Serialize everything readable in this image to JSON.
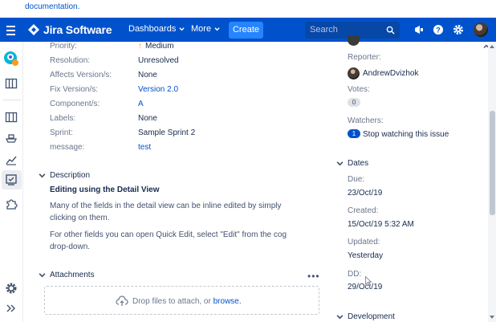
{
  "top_link": "documentation.",
  "nav": {
    "app_name": "Jira Software",
    "dashboards": "Dashboards",
    "more": "More",
    "create": "Create",
    "search_placeholder": "Search"
  },
  "fields": [
    {
      "label": "Priority:",
      "value": "Medium",
      "link": false,
      "icon": "priority-medium-arrow"
    },
    {
      "label": "Resolution:",
      "value": "Unresolved",
      "link": false
    },
    {
      "label": "Affects Version/s:",
      "value": "None",
      "link": false
    },
    {
      "label": "Fix Version/s:",
      "value": "Version 2.0",
      "link": true
    },
    {
      "label": "Component/s:",
      "value": "A",
      "link": true
    },
    {
      "label": "Labels:",
      "value": "None",
      "link": false
    },
    {
      "label": "Sprint:",
      "value": "Sample Sprint 2",
      "link": false
    },
    {
      "label": "message:",
      "value": "test",
      "link": true
    }
  ],
  "description": {
    "heading": "Description",
    "title": "Editing using the Detail View",
    "para1": "Many of the fields in the detail view can be inline edited by simply clicking on them.",
    "para2": "For other fields you can open Quick Edit, select \"Edit\" from the cog drop-down."
  },
  "attachments": {
    "heading": "Attachments",
    "drop_text": "Drop files to attach, or",
    "browse": "browse."
  },
  "people": {
    "reporter_label": "Reporter:",
    "reporter_name": "AndrewDvizhok",
    "votes_label": "Votes:",
    "votes_count": "0",
    "watchers_label": "Watchers:",
    "watchers_count": "1",
    "watch_link": "Stop watching this issue"
  },
  "dates": {
    "heading": "Dates",
    "due_label": "Due:",
    "due_value": "23/Oct/19",
    "created_label": "Created:",
    "created_value": "15/Oct/19 5:32 AM",
    "updated_label": "Updated:",
    "updated_value": "Yesterday",
    "dd_label": "DD:",
    "dd_value": "29/Oct/19"
  },
  "development": {
    "heading": "Development"
  },
  "colors": {
    "nav_bg": "#0052cc",
    "link": "#0052cc",
    "create_btn": "#2684ff",
    "priority_medium": "#ff991f"
  }
}
